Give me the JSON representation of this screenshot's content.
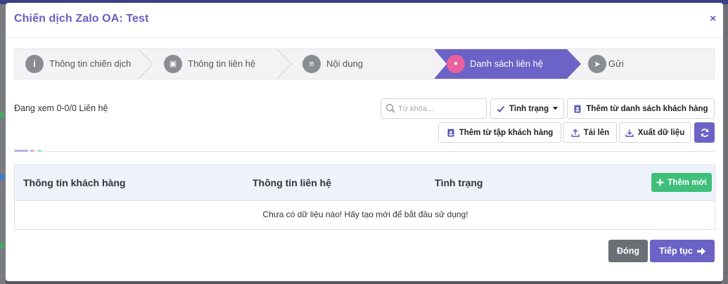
{
  "modal": {
    "title": "Chiến dịch Zalo OA: Test",
    "close_label": "×"
  },
  "steps": [
    {
      "label": "Thông tin chiến dịch",
      "icon": "info-icon",
      "glyph": "i"
    },
    {
      "label": "Thông tin liên hệ",
      "icon": "contact-card-icon",
      "glyph": "▣"
    },
    {
      "label": "Nội dung",
      "icon": "document-icon",
      "glyph": "≡"
    },
    {
      "label": "Danh sách liên hệ",
      "icon": "user-icon",
      "glyph": "●"
    },
    {
      "label": "Gửi",
      "icon": "paper-plane-icon",
      "glyph": "➤"
    }
  ],
  "active_step": 3,
  "toolbar": {
    "viewing_text": "Đang xem 0-0/0 Liên hệ",
    "search_placeholder": "Từ khóa...",
    "status_label": "Tình trạng",
    "add_from_customer_list_label": "Thêm từ danh sách khách hàng",
    "add_from_customer_set_label": "Thêm từ tập khách hàng",
    "upload_label": "Tải lên",
    "export_label": "Xuất dữ liệu"
  },
  "table": {
    "columns": [
      "Thông tin khách hàng",
      "Thông tin liên hệ",
      "Tình trạng"
    ],
    "add_new_label": "Thêm mới",
    "empty_message": "Chưa có dữ liệu nào! Hãy tạo mới để bắt đầu sử dụng!"
  },
  "footer": {
    "close_label": "Đóng",
    "continue_label": "Tiếp tục"
  },
  "colors": {
    "accent": "#6a5fc1",
    "active_step": "#6b63c6",
    "active_step_icon": "#e8609e",
    "success": "#3fbf7a",
    "close_button": "#6b6f76",
    "continue_button": "#6b63c6",
    "refresh_button": "#6b63c6"
  }
}
